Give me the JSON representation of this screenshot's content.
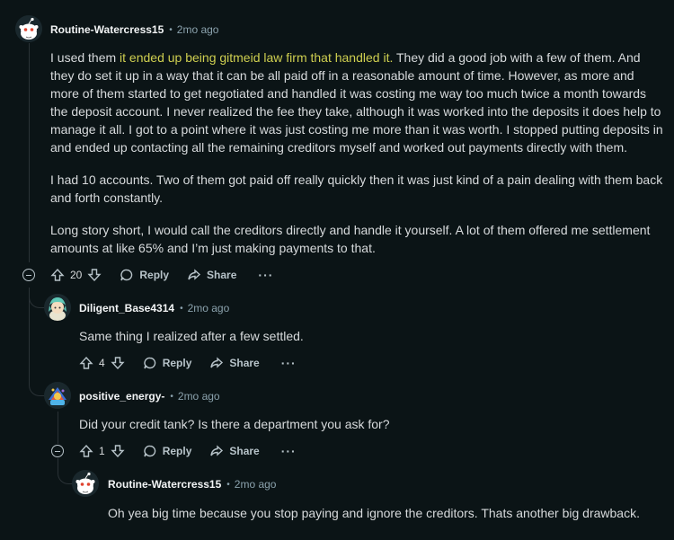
{
  "comments": [
    {
      "author": "Routine-Watercress15",
      "time": "2mo ago",
      "body": {
        "p1_before": "I used them ",
        "p1_link": "it ended up being gitmeid law firm that handled it.",
        "p1_after": " They did a good job with a few of them. And they do set it up in a way that it can be all paid off in a reasonable amount of time. However, as more and more of them started to get negotiated and handled it was costing me way too much twice a month towards the deposit account. I never realized the fee they take, although it was worked into the deposits it does help to manage it all. I got to a point where it was just costing me more than it was worth. I stopped putting deposits in and ended up contacting all the remaining creditors myself and worked out payments directly with them.",
        "p2": "I had 10 accounts. Two of them got paid off really quickly then it was just kind of a pain dealing with them back and forth constantly.",
        "p3": "Long story short, I would call the creditors directly and handle it yourself. A lot of them offered me settlement amounts at like 65% and I’m just making payments to that."
      },
      "votes": "20"
    },
    {
      "author": "Diligent_Base4314",
      "time": "2mo ago",
      "body": "Same thing I realized after a few settled.",
      "votes": "4"
    },
    {
      "author": "positive_energy-",
      "time": "2mo ago",
      "body": "Did your credit tank? Is there a department you ask for?",
      "votes": "1"
    },
    {
      "author": "Routine-Watercress15",
      "time": "2mo ago",
      "body": "Oh yea big time because you stop paying and ignore the creditors. Thats another big drawback."
    }
  ],
  "actions": {
    "reply": "Reply",
    "share": "Share",
    "more": "···"
  },
  "separator": "•"
}
